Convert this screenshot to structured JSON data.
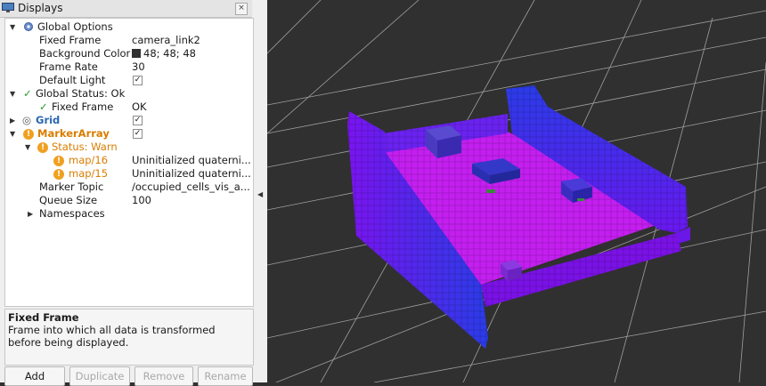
{
  "panel": {
    "title": "Displays",
    "close_glyph": "×",
    "description_title": "Fixed Frame",
    "description_text": "Frame into which all data is transformed before being displayed."
  },
  "tree": {
    "global_options": {
      "label": "Global Options",
      "fixed_frame_label": "Fixed Frame",
      "fixed_frame_value": "camera_link2",
      "background_color_label": "Background Color",
      "background_color_value": "48; 48; 48",
      "frame_rate_label": "Frame Rate",
      "frame_rate_value": "30",
      "default_light_label": "Default Light"
    },
    "global_status": {
      "label": "Global Status: Ok",
      "fixed_frame_label": "Fixed Frame",
      "fixed_frame_value": "OK"
    },
    "grid": {
      "label": "Grid"
    },
    "marker_array": {
      "label": "MarkerArray",
      "status_label": "Status: Warn",
      "map16_label": "map/16",
      "map16_value": "Uninitialized quaterni...",
      "map15_label": "map/15",
      "map15_value": "Uninitialized quaterni...",
      "marker_topic_label": "Marker Topic",
      "marker_topic_value": "/occupied_cells_vis_a...",
      "queue_size_label": "Queue Size",
      "queue_size_value": "100",
      "namespaces_label": "Namespaces"
    }
  },
  "buttons": {
    "add": "Add",
    "duplicate": "Duplicate",
    "remove": "Remove",
    "rename": "Rename"
  },
  "colors": {
    "background": "#303030",
    "warn": "#f0a020",
    "ok": "#2b9b2b",
    "grid_label": "#2a67b2"
  },
  "icons": [
    "monitor-icon",
    "close-icon",
    "gear-icon",
    "check-icon",
    "eye-icon",
    "warning-icon",
    "expand-arrow-icon",
    "collapse-arrow-icon"
  ]
}
